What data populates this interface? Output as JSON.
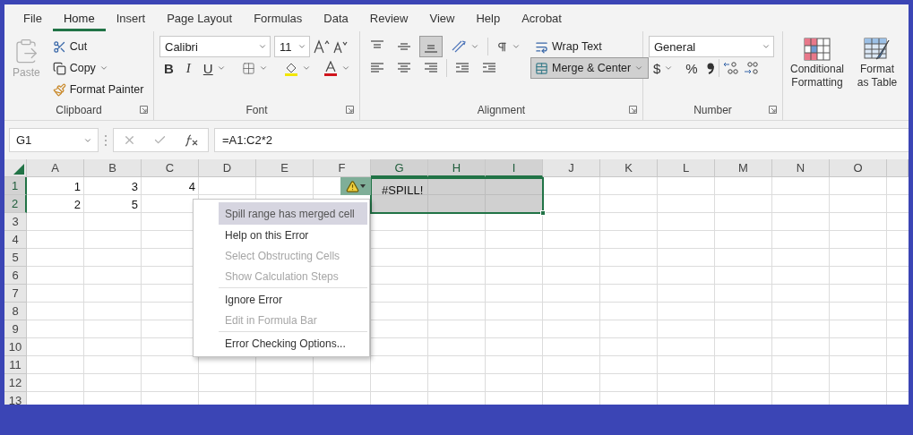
{
  "tabs": [
    {
      "label": "File",
      "selected": false
    },
    {
      "label": "Home",
      "selected": true
    },
    {
      "label": "Insert",
      "selected": false
    },
    {
      "label": "Page Layout",
      "selected": false
    },
    {
      "label": "Formulas",
      "selected": false
    },
    {
      "label": "Data",
      "selected": false
    },
    {
      "label": "Review",
      "selected": false
    },
    {
      "label": "View",
      "selected": false
    },
    {
      "label": "Help",
      "selected": false
    },
    {
      "label": "Acrobat",
      "selected": false
    }
  ],
  "clipboard": {
    "label": "Clipboard",
    "paste": {
      "label": "Paste",
      "disabled": true
    },
    "cut": "Cut",
    "copy": "Copy",
    "format_painter": "Format Painter"
  },
  "font": {
    "label": "Font",
    "font_name": "Calibri",
    "font_size": "11",
    "bold": "B",
    "italic": "I",
    "underline": "U"
  },
  "alignment": {
    "label": "Alignment",
    "vertical": [
      {
        "kind": "top",
        "selected": false
      },
      {
        "kind": "middle",
        "selected": false
      },
      {
        "kind": "bottom",
        "selected": true
      }
    ],
    "wrap_text": {
      "label": "Wrap Text",
      "selected": false
    },
    "merge_center": {
      "label": "Merge & Center",
      "selected": true
    }
  },
  "number": {
    "label": "Number",
    "format": "General",
    "currency": "$",
    "percent": "%"
  },
  "styles": [
    {
      "kind": "conditional",
      "label": "Conditional Formatting"
    },
    {
      "kind": "table",
      "label": "Format as Table"
    }
  ],
  "formula_bar": {
    "name_box": "G1",
    "formula": "=A1:C2*2"
  },
  "sheet": {
    "columns": [
      {
        "label": "A",
        "selected": false
      },
      {
        "label": "B",
        "selected": false
      },
      {
        "label": "C",
        "selected": false
      },
      {
        "label": "D",
        "selected": false
      },
      {
        "label": "E",
        "selected": false
      },
      {
        "label": "F",
        "selected": false
      },
      {
        "label": "G",
        "selected": true
      },
      {
        "label": "H",
        "selected": true
      },
      {
        "label": "I",
        "selected": true
      },
      {
        "label": "J",
        "selected": false
      },
      {
        "label": "K",
        "selected": false
      },
      {
        "label": "L",
        "selected": false
      },
      {
        "label": "M",
        "selected": false
      },
      {
        "label": "N",
        "selected": false
      },
      {
        "label": "O",
        "selected": false
      }
    ],
    "rows": [
      {
        "label": "1",
        "selected": true,
        "cells": [
          "1",
          "3",
          "4"
        ]
      },
      {
        "label": "2",
        "selected": true,
        "cells": [
          "2",
          "5"
        ]
      },
      {
        "label": "3",
        "selected": false
      },
      {
        "label": "4",
        "selected": false
      },
      {
        "label": "5",
        "selected": false
      },
      {
        "label": "6",
        "selected": false
      },
      {
        "label": "7",
        "selected": false
      },
      {
        "label": "8",
        "selected": false
      },
      {
        "label": "9",
        "selected": false
      },
      {
        "label": "10",
        "selected": false
      },
      {
        "label": "11",
        "selected": false
      },
      {
        "label": "12",
        "selected": false
      },
      {
        "label": "13",
        "selected": false
      }
    ],
    "spill_cell": "#SPILL!"
  },
  "error_menu": {
    "items": [
      {
        "kind": "header",
        "label": "Spill range has merged cell"
      },
      {
        "kind": "item",
        "label": "Help on this Error",
        "disabled": false
      },
      {
        "kind": "item",
        "label": "Select Obstructing Cells",
        "disabled": true
      },
      {
        "kind": "item",
        "label": "Show Calculation Steps",
        "disabled": true
      },
      {
        "kind": "separator"
      },
      {
        "kind": "item",
        "label": "Ignore Error",
        "disabled": false
      },
      {
        "kind": "item",
        "label": "Edit in Formula Bar",
        "disabled": true
      },
      {
        "kind": "separator"
      },
      {
        "kind": "item",
        "label": "Error Checking Options...",
        "disabled": false
      }
    ]
  }
}
